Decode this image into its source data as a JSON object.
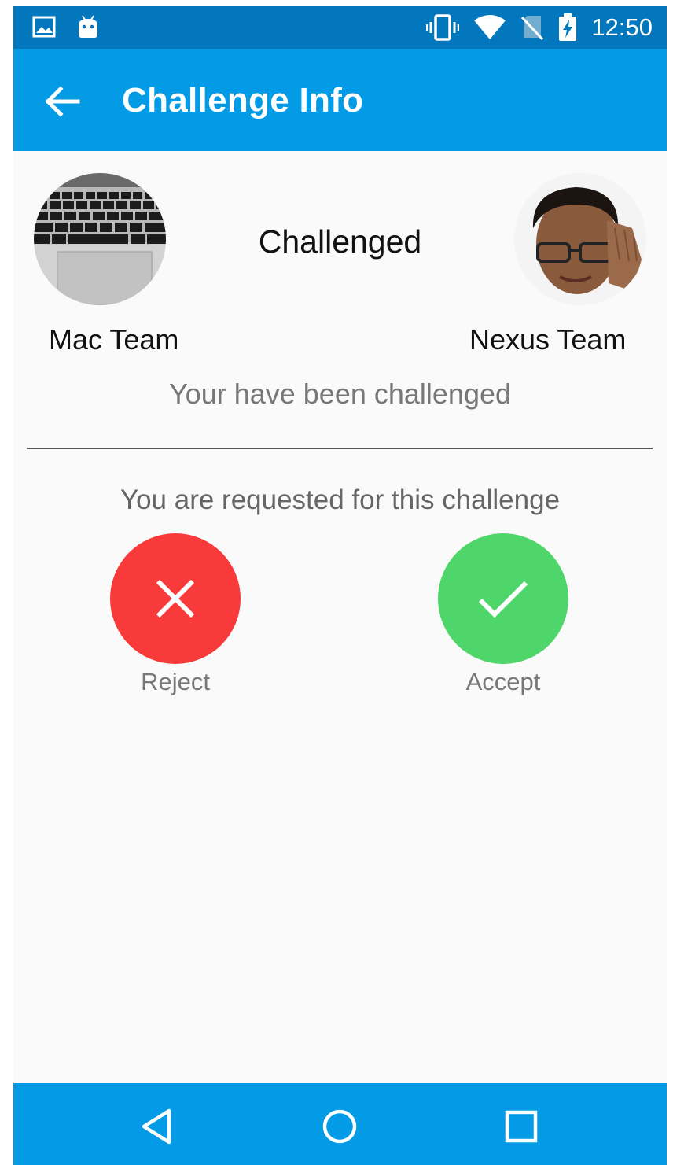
{
  "status_bar": {
    "time": "12:50",
    "icons": [
      "image-icon",
      "android-icon",
      "vibrate-icon",
      "wifi-icon",
      "no-sim-icon",
      "battery-charging-icon"
    ]
  },
  "app_bar": {
    "title": "Challenge Info",
    "back_icon": "arrow-left-icon"
  },
  "challenge": {
    "status": "Challenged",
    "challenger_team": "Mac Team",
    "challenged_team": "Nexus Team",
    "message": "Your have been challenged"
  },
  "request": {
    "text": "You are requested for this challenge",
    "reject_label": "Reject",
    "accept_label": "Accept"
  },
  "nav_bar": {
    "icons": [
      "back-triangle-icon",
      "home-circle-icon",
      "recents-square-icon"
    ]
  },
  "colors": {
    "status_bar": "#0277bd",
    "primary": "#039be5",
    "reject": "#f83a3a",
    "accept": "#4fd66a"
  }
}
